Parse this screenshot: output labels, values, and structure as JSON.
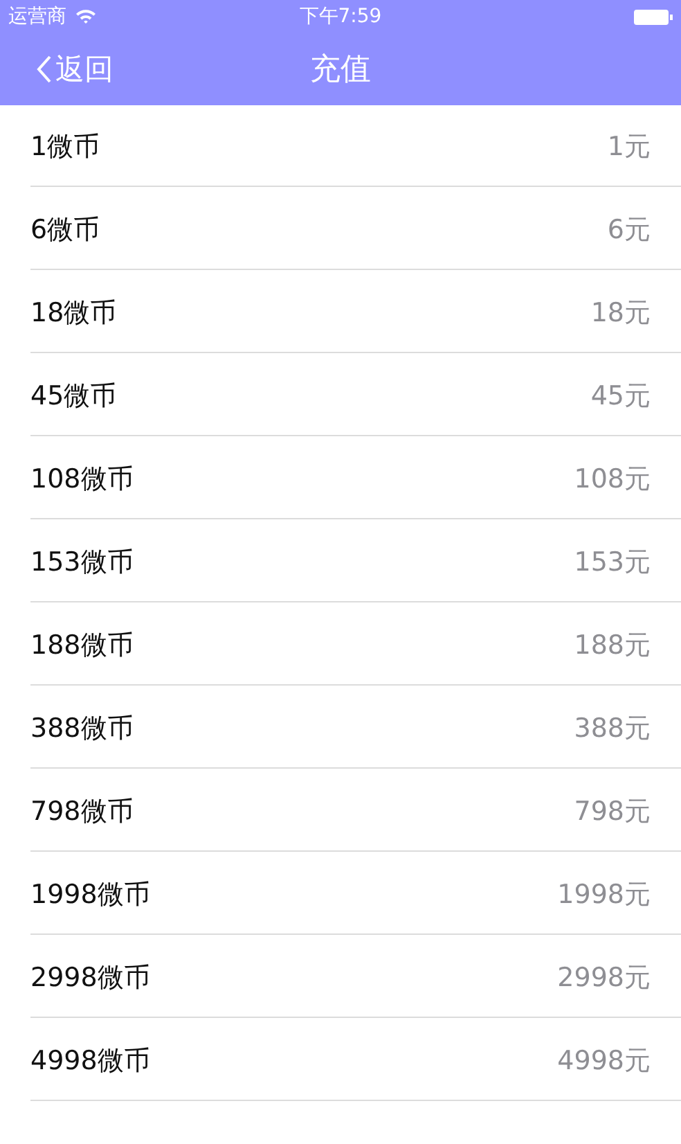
{
  "status_bar": {
    "carrier": "运营商",
    "time": "下午7:59"
  },
  "nav_bar": {
    "back": "返回",
    "title": "充值"
  },
  "items": [
    {
      "name": "1微币",
      "price": "1元"
    },
    {
      "name": "6微币",
      "price": "6元"
    },
    {
      "name": "18微币",
      "price": "18元"
    },
    {
      "name": "45微币",
      "price": "45元"
    },
    {
      "name": "108微币",
      "price": "108元"
    },
    {
      "name": "153微币",
      "price": "153元"
    },
    {
      "name": "188微币",
      "price": "188元"
    },
    {
      "name": "388微币",
      "price": "388元"
    },
    {
      "name": "798微币",
      "price": "798元"
    },
    {
      "name": "1998微币",
      "price": "1998元"
    },
    {
      "name": "2998微币",
      "price": "2998元"
    },
    {
      "name": "4998微币",
      "price": "4998元"
    }
  ]
}
